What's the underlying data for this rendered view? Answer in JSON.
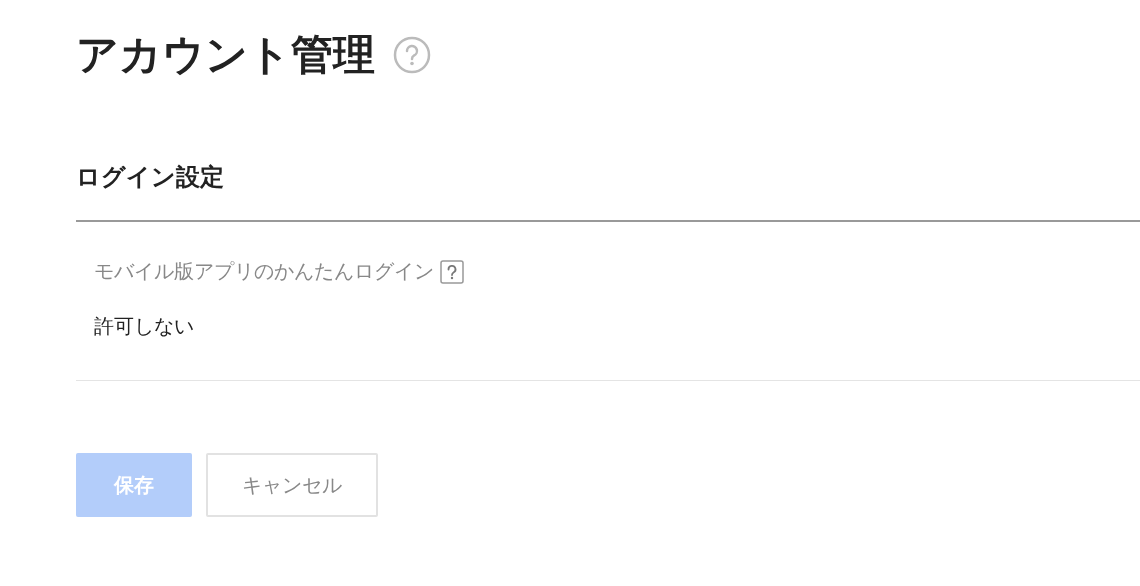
{
  "page": {
    "title": "アカウント管理"
  },
  "section": {
    "heading": "ログイン設定",
    "fields": [
      {
        "label": "モバイル版アプリのかんたんログイン",
        "value": "許可しない"
      }
    ]
  },
  "buttons": [
    {
      "kind": "primary",
      "label": "保存",
      "disabled": true
    },
    {
      "kind": "secondary",
      "label": "キャンセル",
      "disabled": false
    }
  ]
}
